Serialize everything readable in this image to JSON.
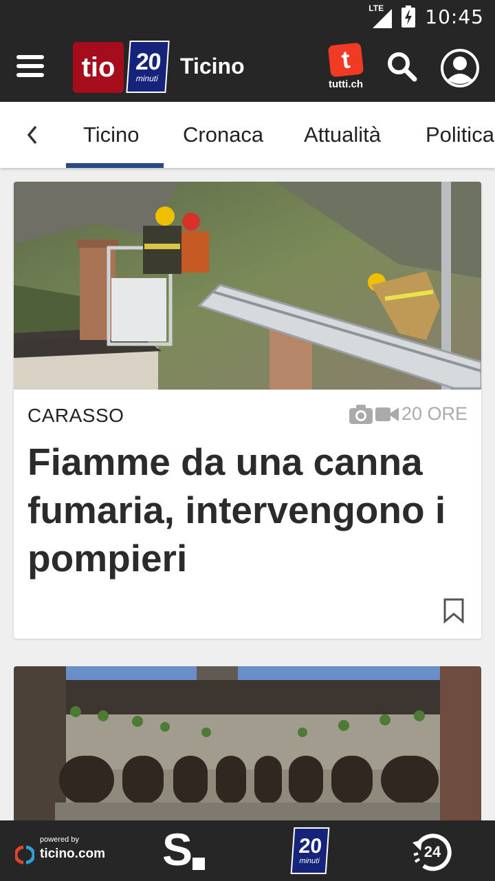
{
  "status_bar": {
    "time": "10:45",
    "network": "LTE"
  },
  "app_bar": {
    "logo_tio": "tio",
    "logo_20_number": "20",
    "logo_20_word": "minuti",
    "region": "Ticino",
    "tutti_letter": "t",
    "tutti_label": "tutti.ch",
    "icons": [
      "menu-icon",
      "search-icon",
      "account-icon"
    ]
  },
  "tabs": {
    "items": [
      "Ticino",
      "Cronaca",
      "Attualità",
      "Politica"
    ],
    "active": "Ticino",
    "accent": "#2a4a85"
  },
  "article": {
    "location": "CARASSO",
    "age": "20 ORE",
    "title": "Fiamme da una canna fumaria, intervengono i pompieri",
    "media_icons": [
      "camera-icon",
      "video-icon"
    ]
  },
  "bottom_bar": {
    "powered_by": "powered by",
    "site": "ticino.com",
    "s_logo": "S",
    "b20_number": "20",
    "b20_word": "minuti",
    "b24_label": "24"
  },
  "colors": {
    "bar": "#262626",
    "tio_red": "#a50d1c",
    "minuti_blue": "#15237a",
    "tutti_red": "#f03a23"
  }
}
